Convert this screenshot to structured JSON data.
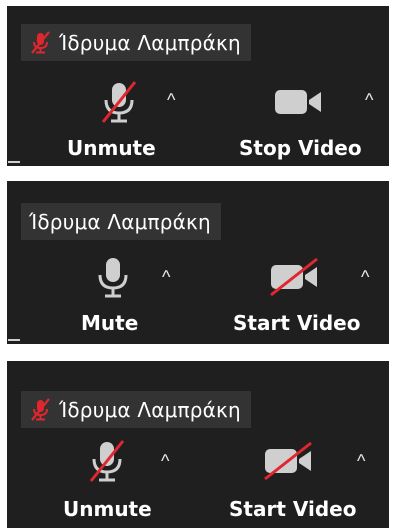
{
  "panels": [
    {
      "participant_name": "Ίδρυμα Λαμπράκη",
      "name_muted_icon": "mic-muted-red-icon",
      "audio": {
        "label": "Unmute",
        "icon": "mic-off-icon",
        "state": "muted"
      },
      "video": {
        "label": "Stop Video",
        "icon": "video-camera-icon",
        "state": "on"
      },
      "caret": "^"
    },
    {
      "participant_name": "Ίδρυμα Λαμπράκη",
      "audio": {
        "label": "Mute",
        "icon": "mic-icon",
        "state": "unmuted"
      },
      "video": {
        "label": "Start Video",
        "icon": "video-off-icon",
        "state": "off"
      },
      "caret": "^"
    },
    {
      "participant_name": "Ίδρυμα Λαμπράκη",
      "name_muted_icon": "mic-muted-red-icon",
      "audio": {
        "label": "Unmute",
        "icon": "mic-off-icon",
        "state": "muted"
      },
      "video": {
        "label": "Start Video",
        "icon": "video-off-icon",
        "state": "off"
      },
      "caret": "^"
    }
  ],
  "colors": {
    "panel_bg": "#1f1f1f",
    "namebar_bg": "#333333",
    "icon_gray": "#cfcfcf",
    "slash_red": "#e0262e",
    "text": "#ffffff"
  }
}
